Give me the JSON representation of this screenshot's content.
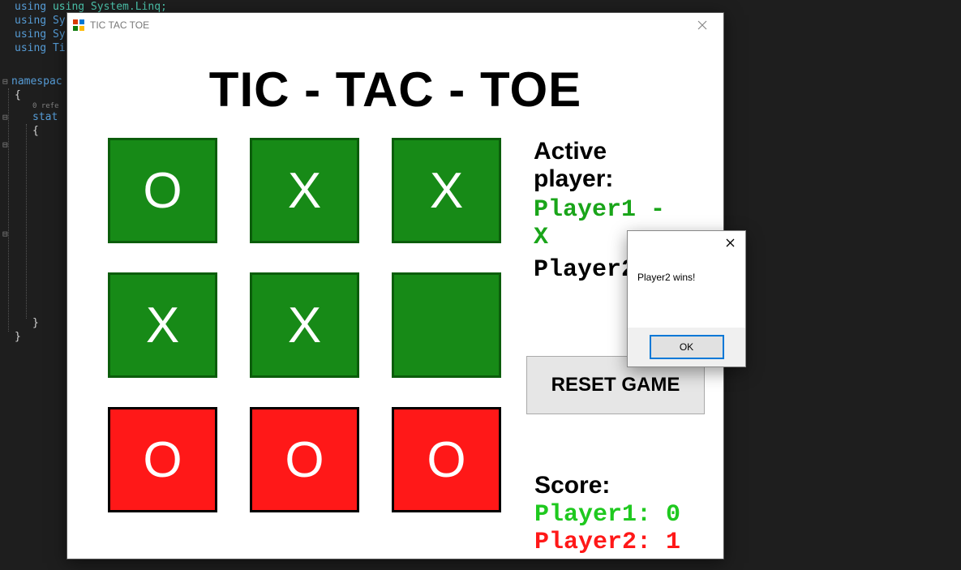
{
  "editor": {
    "line1": "using System.Linq;",
    "line2": "using Sy",
    "line3": "using Sy",
    "line4": "using Ti",
    "line5": "namespac",
    "line6": "{",
    "line7": "0 refe",
    "line8": "stat",
    "line9": "{",
    "line10": "}",
    "line11": "}"
  },
  "window": {
    "title": "TIC TAC TOE",
    "heading": "TIC - TAC - TOE",
    "active_label": "Active player:",
    "player1_label": "Player1 - X",
    "player2_label": "Player2",
    "reset_label": "RESET GAME",
    "score_label": "Score:",
    "score_p1": "Player1:  0",
    "score_p2": "Player2:  1"
  },
  "board": {
    "cells": [
      "O",
      "X",
      "X",
      "X",
      "X",
      "",
      "O",
      "O",
      "O"
    ],
    "win_row": 2
  },
  "msgbox": {
    "text": "Player2 wins!",
    "ok": "OK"
  }
}
